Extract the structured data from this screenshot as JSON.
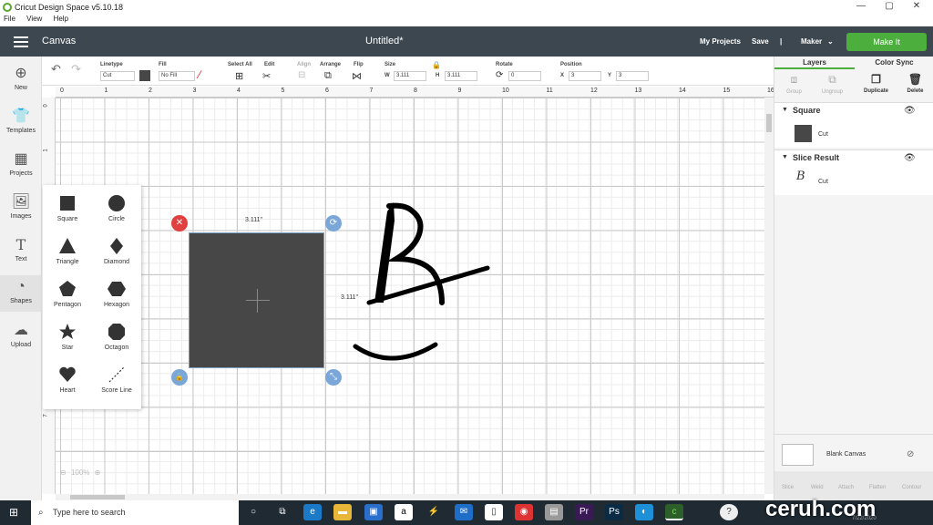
{
  "window": {
    "app_title": "Cricut Design Space  v5.10.18",
    "menu": [
      "File",
      "View",
      "Help"
    ]
  },
  "header": {
    "canvas_label": "Canvas",
    "doc_title": "Untitled*",
    "my_projects": "My Projects",
    "save": "Save",
    "machine": "Maker",
    "make_it": "Make It"
  },
  "left_toolbar": {
    "items": [
      {
        "label": "New",
        "icon": "plus-circle-icon"
      },
      {
        "label": "Templates",
        "icon": "shirt-icon"
      },
      {
        "label": "Projects",
        "icon": "grid-icon"
      },
      {
        "label": "Images",
        "icon": "image-icon"
      },
      {
        "label": "Text",
        "icon": "text-icon"
      },
      {
        "label": "Shapes",
        "icon": "shapes-icon"
      },
      {
        "label": "Upload",
        "icon": "cloud-upload-icon"
      }
    ]
  },
  "edit_toolbar": {
    "linetype_label": "Linetype",
    "linetype_value": "Cut",
    "fill_label": "Fill",
    "fill_value": "No Fill",
    "select_all": "Select All",
    "edit": "Edit",
    "align": "Align",
    "arrange": "Arrange",
    "flip": "Flip",
    "size_label": "Size",
    "w_label": "W",
    "w_value": "3.111",
    "h_label": "H",
    "h_value": "3.111",
    "rotate_label": "Rotate",
    "rotate_value": "0",
    "position_label": "Position",
    "x_label": "X",
    "x_value": "3",
    "y_label": "Y",
    "y_value": "3"
  },
  "ruler": {
    "h": [
      "0",
      "1",
      "2",
      "3",
      "4",
      "5",
      "6",
      "7",
      "8",
      "9",
      "10",
      "11",
      "12",
      "13",
      "14",
      "15",
      "16"
    ],
    "v": [
      "0",
      "1",
      "2",
      "3",
      "4",
      "5",
      "6",
      "7"
    ]
  },
  "shapes_panel": {
    "items": [
      "Square",
      "Circle",
      "Triangle",
      "Diamond",
      "Pentagon",
      "Hexagon",
      "Star",
      "Octagon",
      "Heart",
      "Score Line"
    ]
  },
  "canvas": {
    "width_label": "3.111\"",
    "height_label": "3.111\"",
    "zoom": "100%"
  },
  "right_panel": {
    "tabs": [
      "Layers",
      "Color Sync"
    ],
    "actions": [
      "Group",
      "Ungroup",
      "Duplicate",
      "Delete"
    ],
    "layers": [
      {
        "name": "Square",
        "sub": "Cut"
      },
      {
        "name": "Slice Result",
        "sub": "Cut"
      }
    ],
    "blank_canvas": "Blank Canvas",
    "bottom_actions": [
      "Slice",
      "Weld",
      "Attach",
      "Flatten",
      "Contour"
    ]
  },
  "taskbar": {
    "search_placeholder": "Type here to search",
    "date": "7/22/2020"
  },
  "watermark": "ceruh.com"
}
